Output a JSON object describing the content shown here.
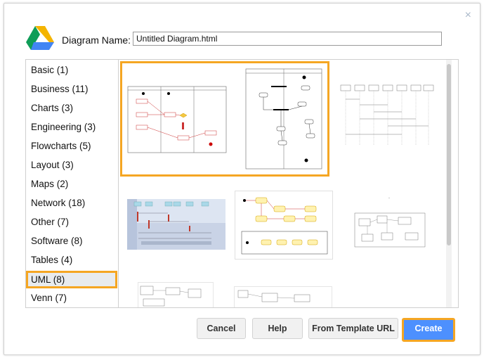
{
  "dialog": {
    "name_label": "Diagram Name:",
    "name_value": "Untitled Diagram.html",
    "close_glyph": "×"
  },
  "sidebar": {
    "items": [
      {
        "label": "Basic (1)"
      },
      {
        "label": "Business (11)"
      },
      {
        "label": "Charts (3)"
      },
      {
        "label": "Engineering (3)"
      },
      {
        "label": "Flowcharts (5)"
      },
      {
        "label": "Layout (3)"
      },
      {
        "label": "Maps (2)"
      },
      {
        "label": "Network (18)"
      },
      {
        "label": "Other (7)"
      },
      {
        "label": "Software (8)"
      },
      {
        "label": "Tables (4)"
      },
      {
        "label": "UML (8)",
        "selected": true
      },
      {
        "label": "Venn (7)"
      }
    ]
  },
  "buttons": {
    "cancel": "Cancel",
    "help": "Help",
    "template_url": "From Template URL",
    "create": "Create"
  },
  "colors": {
    "highlight": "#f5a623",
    "primary": "#4d90fe"
  },
  "icons": [
    "google-drive-logo",
    "close-icon"
  ]
}
